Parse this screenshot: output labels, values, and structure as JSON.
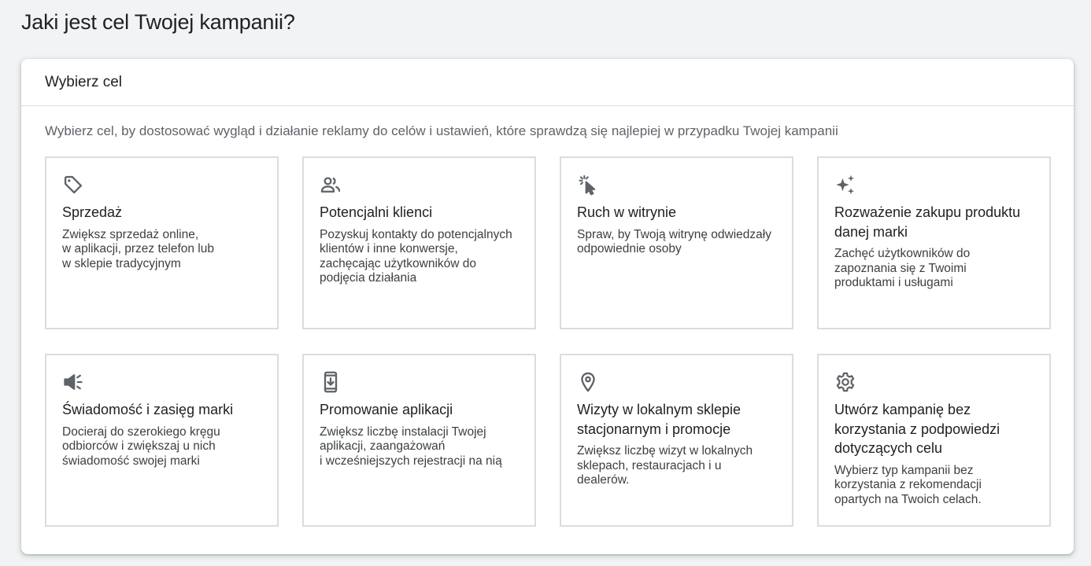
{
  "page": {
    "title": "Jaki jest cel Twojej kampanii?"
  },
  "panel": {
    "title": "Wybierz cel",
    "description": "Wybierz cel, by dostosować wygląd i działanie reklamy do celów i ustawień, które sprawdzą się najlepiej w przypadku Twojej kampanii"
  },
  "cards": [
    {
      "icon": "tag-icon",
      "title": "Sprzedaż",
      "desc_lines": [
        "Zwiększ sprzedaż online,",
        "w aplikacji, przez telefon lub",
        "w sklepie tradycyjnym"
      ]
    },
    {
      "icon": "people-icon",
      "title": "Potencjalni klienci",
      "desc_lines": [
        "Pozyskuj kontakty do potencjalnych",
        "klientów i inne konwersje,",
        "zachęcając użytkowników do",
        "podjęcia działania"
      ]
    },
    {
      "icon": "cursor-click-icon",
      "title": "Ruch w witrynie",
      "desc_lines": [
        "Spraw, by Twoją witrynę odwiedzały",
        "odpowiednie osoby"
      ]
    },
    {
      "icon": "sparkle-icon",
      "title_lines": [
        "Rozważenie zakupu produktu",
        "danej marki"
      ],
      "desc_lines": [
        "Zachęć użytkowników do",
        "zapoznania się z Twoimi",
        "produktami i usługami"
      ]
    },
    {
      "icon": "megaphone-icon",
      "title": "Świadomość i zasięg marki",
      "desc_lines": [
        "Docieraj do szerokiego kręgu",
        "odbiorców i zwiększaj u nich",
        "świadomość swojej marki"
      ]
    },
    {
      "icon": "phone-download-icon",
      "title": "Promowanie aplikacji",
      "desc_lines": [
        "Zwiększ liczbę instalacji Twojej",
        "aplikacji, zaangażowań",
        "i wcześniejszych rejestracji na nią"
      ]
    },
    {
      "icon": "location-pin-icon",
      "title_lines": [
        "Wizyty w lokalnym sklepie",
        "stacjonarnym i promocje"
      ],
      "desc_lines": [
        "Zwiększ liczbę wizyt w lokalnych",
        "sklepach, restauracjach i u",
        "dealerów."
      ]
    },
    {
      "icon": "gear-icon",
      "title_lines": [
        "Utwórz kampanię bez",
        "korzystania z podpowiedzi",
        "dotyczących celu"
      ],
      "desc_lines": [
        "Wybierz typ kampanii bez",
        "korzystania z rekomendacji",
        "opartych na Twoich celach."
      ]
    }
  ],
  "colors": {
    "background": "#f1f3f4",
    "card_border": "#dadce0",
    "icon": "#5f6368",
    "title_text": "#202124"
  }
}
